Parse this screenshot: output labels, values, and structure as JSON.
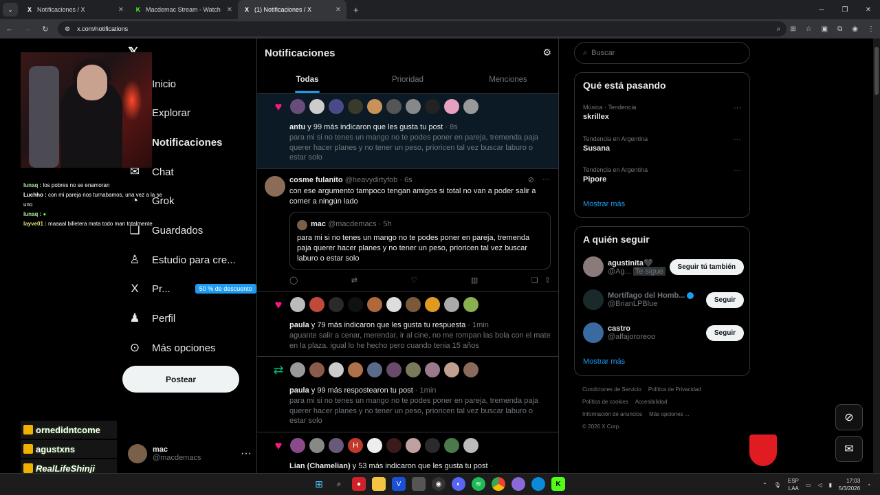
{
  "browser": {
    "tabs": [
      {
        "title": "Notificaciones / X",
        "icon": "X"
      },
      {
        "title": "Macdemac Stream - Watch Live",
        "icon": "K"
      },
      {
        "title": "(1) Notificaciones / X",
        "icon": "X"
      }
    ],
    "url": "x.com/notifications"
  },
  "stream": {
    "chat": [
      {
        "user": "lunaq :",
        "text": "los pobres no se enamoran"
      },
      {
        "user": "Luchho :",
        "text": "con mi pareja nos turnabamos, una vez a la se uno"
      },
      {
        "user": "lunaq :",
        "text": ""
      },
      {
        "user": "layve01 :",
        "text": "maaaal billetera mata todo man totalmente"
      }
    ],
    "subs": [
      "ornedidntcome",
      "agustxns",
      "RealLifeShinji"
    ]
  },
  "sidebar": {
    "items": [
      {
        "label": "Inicio",
        "icon": "home-icon",
        "glyph": "⌂"
      },
      {
        "label": "Explorar",
        "icon": "search-icon",
        "glyph": "⌕"
      },
      {
        "label": "Notificaciones",
        "icon": "bell-icon",
        "glyph": "♫"
      },
      {
        "label": "Chat",
        "icon": "mail-icon",
        "glyph": "✉"
      },
      {
        "label": "Grok",
        "icon": "grok-icon",
        "glyph": "◔"
      },
      {
        "label": "Guardados",
        "icon": "bookmark-icon",
        "glyph": "❏"
      },
      {
        "label": "Estudio para cre...",
        "icon": "studio-icon",
        "glyph": "♙"
      },
      {
        "label": "Pr...",
        "icon": "x-premium-icon",
        "glyph": "X"
      },
      {
        "label": "Perfil",
        "icon": "profile-icon",
        "glyph": "♟"
      },
      {
        "label": "Más opciones",
        "icon": "more-icon",
        "glyph": "⊙"
      }
    ],
    "premium_badge": "50 % de descuento",
    "post_button": "Postear",
    "account": {
      "name": "mac",
      "handle": "@macdemacs"
    }
  },
  "timeline": {
    "title": "Notificaciones",
    "tabs": [
      "Todas",
      "Prioridad",
      "Menciones"
    ],
    "n1": {
      "who": "antu",
      "action": " y 99 más indicaron que les gusta tu post",
      "time": " · 8s",
      "snippet": "para mi si no tenes un mango no te podes poner en pareja, tremenda paja querer hacer planes y no tener un peso, prioricen tal vez buscar laburo o estar solo"
    },
    "post": {
      "name": "cosme fulanito",
      "handle": "@heavydirtyfob",
      "time": "· 6s",
      "body": "con ese argumento tampoco tengan amigos si total no van a poder salir a comer a ningún lado",
      "quote": {
        "name": "mac",
        "handle": "@macdemacs",
        "time": "· 5h",
        "body": "para mi si no tenes un mango no te podes poner en pareja, tremenda paja querer hacer planes y no tener un peso, prioricen tal vez buscar laburo o estar solo"
      }
    },
    "n2": {
      "who": "paula",
      "action": " y 79 más indicaron que les gusta tu respuesta",
      "time": " · 1min",
      "snippet": "aguante salir a cenar, merendar, ir al cine, no me rompan las bola con el mate en la plaza. igual lo he hecho pero cuando tenia 15 años"
    },
    "n3": {
      "who": "paula",
      "action": " y 99 más respostearon tu post",
      "time": " · 1min",
      "snippet": "para mi si no tenes un mango no te podes poner en pareja, tremenda paja querer hacer planes y no tener un peso, prioricen tal vez buscar laburo o estar solo"
    },
    "n4": {
      "who": "Lian (Chamelian)",
      "action": " y 53 más indicaron que les gusta tu post",
      "time": " ·"
    }
  },
  "right": {
    "search_placeholder": "Buscar",
    "trends_title": "Qué está pasando",
    "trends": [
      {
        "meta": "Música · Tendencia",
        "name": "skrillex"
      },
      {
        "meta": "Tendencia en Argentina",
        "name": "Susana"
      },
      {
        "meta": "Tendencia en Argentina",
        "name": "Pipore"
      }
    ],
    "show_more": "Mostrar más",
    "follow_title": "A quién seguir",
    "follow": [
      {
        "name": "agustinita🖤",
        "handle": "@Ag...",
        "tag": "Te sigue",
        "button": "Seguir tú también"
      },
      {
        "name": "Mortífago del Homb...",
        "handle": "@BrianLPBlue",
        "button": "Seguir"
      },
      {
        "name": "castro",
        "handle": "@alfajororeoo",
        "button": "Seguir"
      }
    ],
    "footer": [
      "Condiciones de Servicio",
      "Política de Privacidad",
      "Política de cookies",
      "Accesibilidad",
      "Información de anuncios",
      "Más opciones ...",
      "© 2026 X Corp."
    ]
  },
  "taskbar": {
    "lang": "ESP",
    "region": "LAA",
    "time": "17:03",
    "date": "5/3/2026"
  }
}
